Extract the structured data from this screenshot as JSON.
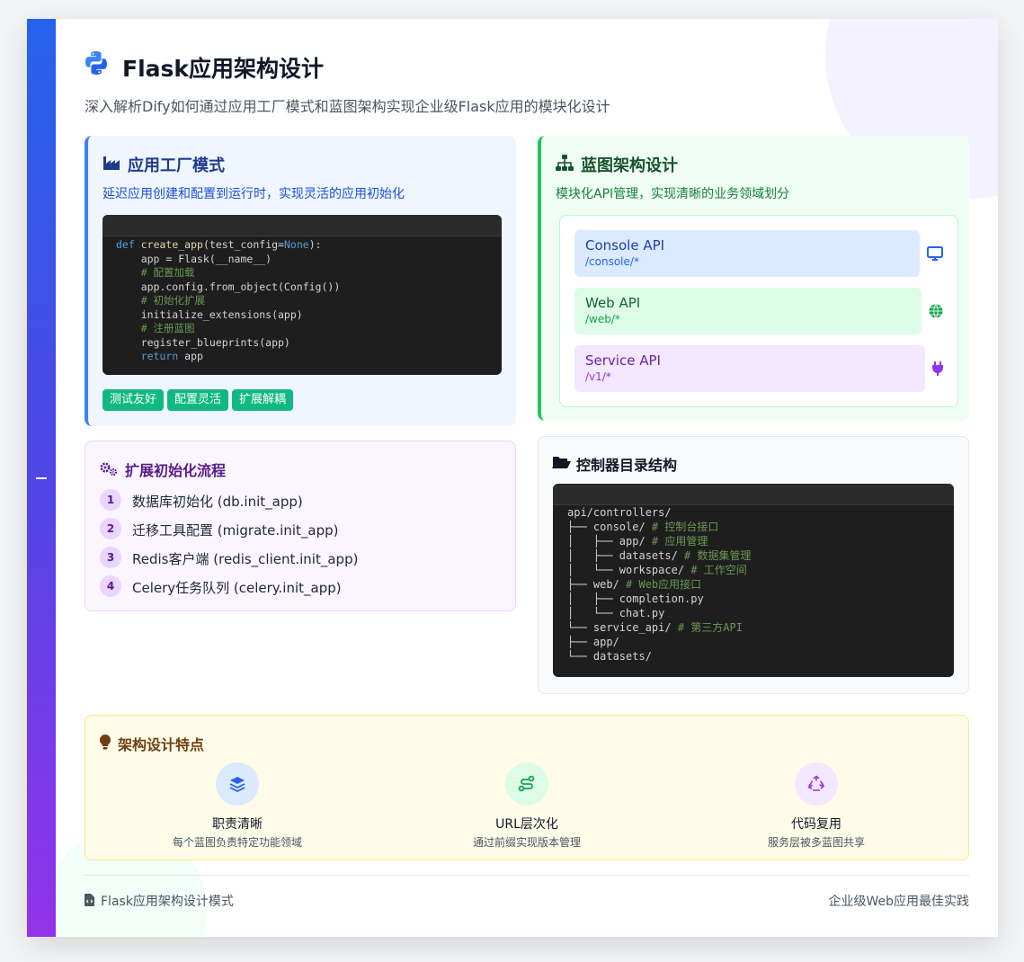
{
  "header": {
    "title": "Flask应用架构设计",
    "subtitle": "深入解析Dify如何通过应用工厂模式和蓝图架构实现企业级Flask应用的模块化设计"
  },
  "factory": {
    "title": "应用工厂模式",
    "desc": "延迟应用创建和配置到运行时，实现灵活的应用初始化",
    "code": {
      "kw_def": "def",
      "fn_name": "create_app",
      "sig_rest": "(test_config=",
      "kw_none": "None",
      "sig_end": "):",
      "l2": "    app = Flask(__name__)",
      "c1": "    # 配置加载",
      "l3": "    app.config.from_object(Config())",
      "c2": "    # 初始化扩展",
      "l4": "    initialize_extensions(app)",
      "c3": "    # 注册蓝图",
      "l5": "    register_blueprints(app)",
      "kw_return": "return",
      "ret_val": " app"
    },
    "tags": [
      "测试友好",
      "配置灵活",
      "扩展解耦"
    ]
  },
  "blueprint": {
    "title": "蓝图架构设计",
    "desc": "模块化API管理，实现清晰的业务领域划分",
    "apis": [
      {
        "name": "Console API",
        "path": "/console/*",
        "icon": "desktop-icon"
      },
      {
        "name": "Web API",
        "path": "/web/*",
        "icon": "globe-icon"
      },
      {
        "name": "Service API",
        "path": "/v1/*",
        "icon": "plug-icon"
      }
    ]
  },
  "extensions": {
    "title": "扩展初始化流程",
    "steps": [
      {
        "num": "1",
        "text": "数据库初始化 (db.init_app)"
      },
      {
        "num": "2",
        "text": "迁移工具配置 (migrate.init_app)"
      },
      {
        "num": "3",
        "text": "Redis客户端 (redis_client.init_app)"
      },
      {
        "num": "4",
        "text": "Celery任务队列 (celery.init_app)"
      }
    ]
  },
  "controllers": {
    "title": "控制器目录结构",
    "tree": [
      {
        "t": "api/controllers/",
        "c": ""
      },
      {
        "t": "├── console/",
        "c": " # 控制台接口"
      },
      {
        "t": "│   ├── app/",
        "c": " # 应用管理"
      },
      {
        "t": "│   ├── datasets/",
        "c": " # 数据集管理"
      },
      {
        "t": "│   └── workspace/",
        "c": " # 工作空间"
      },
      {
        "t": "├── web/",
        "c": " # Web应用接口"
      },
      {
        "t": "│   ├── completion.py",
        "c": ""
      },
      {
        "t": "│   └── chat.py",
        "c": ""
      },
      {
        "t": "└── service_api/",
        "c": " # 第三方API"
      },
      {
        "t": "├── app/",
        "c": ""
      },
      {
        "t": "└── datasets/",
        "c": ""
      }
    ]
  },
  "features": {
    "title": "架构设计特点",
    "items": [
      {
        "title": "职责清晰",
        "desc": "每个蓝图负责特定功能领域",
        "icon": "layers-icon"
      },
      {
        "title": "URL层次化",
        "desc": "通过前缀实现版本管理",
        "icon": "route-icon"
      },
      {
        "title": "代码复用",
        "desc": "服务层被多蓝图共享",
        "icon": "recycle-icon"
      }
    ]
  },
  "footer": {
    "left": "Flask应用架构设计模式",
    "right": "企业级Web应用最佳实践"
  }
}
